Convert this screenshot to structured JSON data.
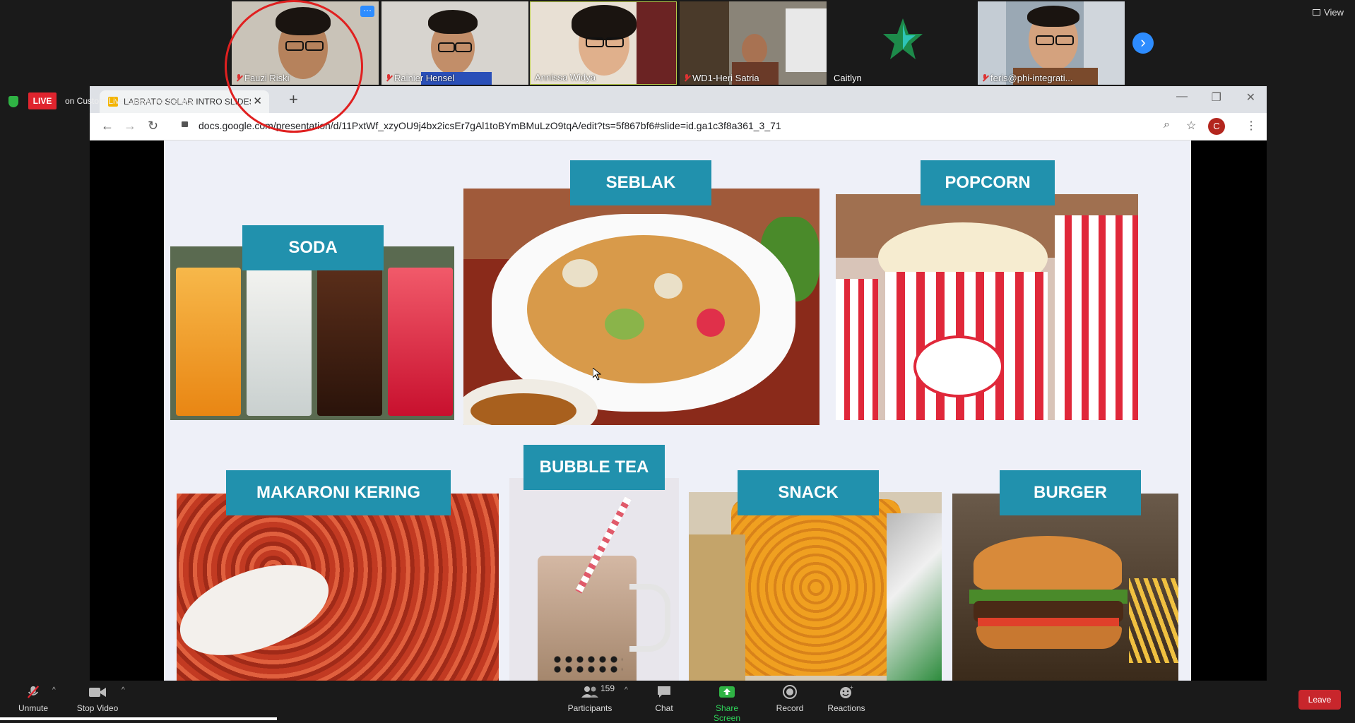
{
  "participants": [
    {
      "name": "Fauzi Riski",
      "muted": true
    },
    {
      "name": "Rainier Hensel",
      "muted": true
    },
    {
      "name": "Annissa Widya",
      "muted": false
    },
    {
      "name": "WD1-Heri Satria",
      "muted": true
    },
    {
      "name": "Caitlyn",
      "muted": false
    },
    {
      "name": "feris@phi-integrati...",
      "muted": true
    }
  ],
  "view_label": "View",
  "more_label": "···",
  "live": {
    "badge": "LIVE",
    "text": "on Custom Live Streaming Service"
  },
  "browser": {
    "tab_title": "LABRATO SOLAR INTRO SLIDES",
    "url": "docs.google.com/presentation/d/11PxtWf_xzyOU9j4bx2icsEr7gAl1toBYmBMuLzO9tqA/edit?ts=5f867bf6#slide=id.ga1c3f8a361_3_71",
    "profile_initial": "C"
  },
  "slide": {
    "labels": {
      "soda": "SODA",
      "seblak": "SEBLAK",
      "popcorn": "POPCORN",
      "makaroni": "MAKARONI KERING",
      "bubble_tea": "BUBBLE TEA",
      "snack": "SNACK",
      "burger": "BURGER"
    }
  },
  "toolbar": {
    "unmute": "Unmute",
    "stop_video": "Stop Video",
    "participants": "Participants",
    "participants_count": "159",
    "chat": "Chat",
    "share_screen": "Share Screen",
    "record": "Record",
    "reactions": "Reactions",
    "leave": "Leave"
  },
  "colors": {
    "label_bg": "#2191ad",
    "zoom_blue": "#2d8cff",
    "live_red": "#e0242e",
    "share_green": "#2fb344",
    "leave_red": "#c8262c"
  }
}
